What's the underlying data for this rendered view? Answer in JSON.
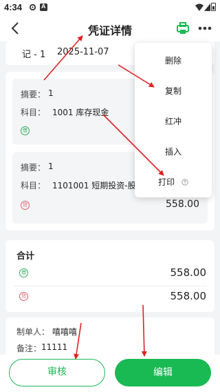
{
  "status_bar": {
    "time": "4:34"
  },
  "header": {
    "title": "凭证详情"
  },
  "voucher": {
    "number": "记 - 1",
    "date": "2025-11-07"
  },
  "entries": [
    {
      "summary_label": "摘要：",
      "summary": "1",
      "subject_label": "科目：",
      "subject": "1001 库存现金",
      "direction": "借",
      "amount": ""
    },
    {
      "summary_label": "摘要：",
      "summary": "1",
      "subject_label": "科目：",
      "subject": "1101001 短期投资-股",
      "direction": "贷",
      "amount": "558.00"
    }
  ],
  "totals": {
    "title": "合计",
    "debit_badge": "借",
    "debit": "558.00",
    "credit_badge": "贷",
    "credit": "558.00"
  },
  "info": {
    "maker_label": "制单人：",
    "maker": "嘻嘻嘻",
    "note_label": "备注：",
    "note": "11111"
  },
  "menu": {
    "items": [
      "删除",
      "复制",
      "红冲",
      "插入",
      "打印"
    ]
  },
  "buttons": {
    "review": "审核",
    "edit": "编辑"
  },
  "colors": {
    "accent": "#19b954",
    "annotation": "#e02020",
    "debit": "#2eaa55",
    "credit": "#e05a6a"
  }
}
